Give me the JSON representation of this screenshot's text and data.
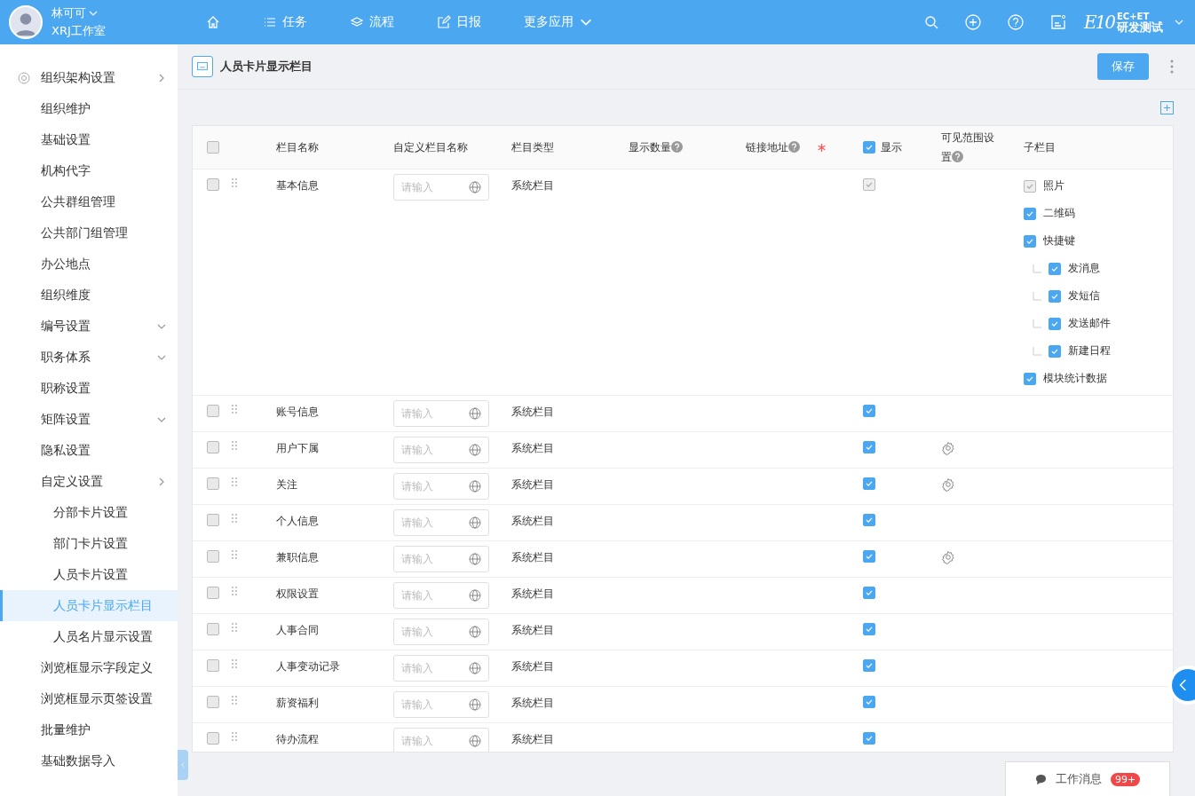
{
  "user": {
    "name": "林可可",
    "org": "XRJ工作室"
  },
  "nav": [
    {
      "kind": "home"
    },
    {
      "kind": "list",
      "label": "任务"
    },
    {
      "kind": "layers",
      "label": "流程"
    },
    {
      "kind": "edit",
      "label": "日报"
    },
    {
      "kind": "more",
      "label": "更多应用"
    }
  ],
  "brand": {
    "mark": "E10",
    "top": "EC+ET",
    "bottom": "研发测试"
  },
  "sidebar": {
    "items": [
      {
        "label": "组织架构设置",
        "expanded": true,
        "selected": false,
        "children": [
          {
            "label": "组织维护",
            "selected": false
          },
          {
            "label": "基础设置",
            "selected": false
          },
          {
            "label": "机构代字",
            "selected": false
          },
          {
            "label": "公共群组管理",
            "selected": false
          },
          {
            "label": "公共部门组管理",
            "selected": false
          },
          {
            "label": "办公地点",
            "selected": false
          },
          {
            "label": "组织维度",
            "selected": false
          },
          {
            "label": "编号设置",
            "expanded": false,
            "selected": false
          },
          {
            "label": "职务体系",
            "expanded": false,
            "selected": false
          },
          {
            "label": "职称设置",
            "selected": false
          },
          {
            "label": "矩阵设置",
            "expanded": false,
            "selected": false
          },
          {
            "label": "隐私设置",
            "selected": false
          },
          {
            "label": "自定义设置",
            "expanded": true,
            "selected": false,
            "children": [
              {
                "label": "分部卡片设置",
                "selected": false
              },
              {
                "label": "部门卡片设置",
                "selected": false
              },
              {
                "label": "人员卡片设置",
                "selected": false
              },
              {
                "label": "人员卡片显示栏目",
                "selected": true
              },
              {
                "label": "人员名片显示设置",
                "selected": false
              }
            ]
          },
          {
            "label": "浏览框显示字段定义",
            "selected": false
          },
          {
            "label": "浏览框显示页签设置",
            "selected": false
          },
          {
            "label": "批量维护",
            "selected": false
          },
          {
            "label": "基础数据导入",
            "selected": false
          }
        ]
      }
    ]
  },
  "page": {
    "title": "人员卡片显示栏目",
    "save": "保存"
  },
  "table": {
    "columns": [
      {
        "label": "栏目名称"
      },
      {
        "label": "自定义栏目名称"
      },
      {
        "label": "栏目类型"
      },
      {
        "label": "显示数量",
        "help": true
      },
      {
        "label": "链接地址",
        "help": true,
        "required": true
      },
      {
        "label": "显示",
        "checked": true
      },
      {
        "label": "可见范围设置",
        "help": true
      },
      {
        "label": "子栏目"
      }
    ],
    "all_checked": false,
    "rows": [
      {
        "name": "基本信息",
        "placeholder": "请输入",
        "type": "系统栏目",
        "checked": false,
        "show": true,
        "show_disabled": true,
        "scope_settings": false,
        "children": [
          {
            "label": "照片",
            "checked": true,
            "disabled": true
          },
          {
            "label": "二维码",
            "checked": true,
            "disabled": false
          },
          {
            "label": "快捷键",
            "checked": true,
            "disabled": false,
            "children": [
              {
                "label": "发消息",
                "checked": true,
                "disabled": false
              },
              {
                "label": "发短信",
                "checked": true,
                "disabled": false
              },
              {
                "label": "发送邮件",
                "checked": true,
                "disabled": false
              },
              {
                "label": "新建日程",
                "checked": true,
                "disabled": false
              }
            ]
          },
          {
            "label": "模块统计数据",
            "checked": true,
            "disabled": false
          }
        ]
      },
      {
        "name": "账号信息",
        "placeholder": "请输入",
        "type": "系统栏目",
        "checked": false,
        "show": true,
        "show_disabled": false,
        "scope_settings": false
      },
      {
        "name": "用户下属",
        "placeholder": "请输入",
        "type": "系统栏目",
        "checked": false,
        "show": true,
        "show_disabled": false,
        "scope_settings": true
      },
      {
        "name": "关注",
        "placeholder": "请输入",
        "type": "系统栏目",
        "checked": false,
        "show": true,
        "show_disabled": false,
        "scope_settings": true
      },
      {
        "name": "个人信息",
        "placeholder": "请输入",
        "type": "系统栏目",
        "checked": false,
        "show": true,
        "show_disabled": false,
        "scope_settings": false
      },
      {
        "name": "兼职信息",
        "placeholder": "请输入",
        "type": "系统栏目",
        "checked": false,
        "show": true,
        "show_disabled": false,
        "scope_settings": true
      },
      {
        "name": "权限设置",
        "placeholder": "请输入",
        "type": "系统栏目",
        "checked": false,
        "show": true,
        "show_disabled": false,
        "scope_settings": false
      },
      {
        "name": "人事合同",
        "placeholder": "请输入",
        "type": "系统栏目",
        "checked": false,
        "show": true,
        "show_disabled": false,
        "scope_settings": false
      },
      {
        "name": "人事变动记录",
        "placeholder": "请输入",
        "type": "系统栏目",
        "checked": false,
        "show": true,
        "show_disabled": false,
        "scope_settings": false
      },
      {
        "name": "薪资福利",
        "placeholder": "请输入",
        "type": "系统栏目",
        "checked": false,
        "show": true,
        "show_disabled": false,
        "scope_settings": false
      },
      {
        "name": "待办流程",
        "placeholder": "请输入",
        "type": "系统栏目",
        "checked": false,
        "show": true,
        "show_disabled": false,
        "scope_settings": false
      }
    ]
  },
  "messages": {
    "label": "工作消息",
    "count": "99+"
  }
}
